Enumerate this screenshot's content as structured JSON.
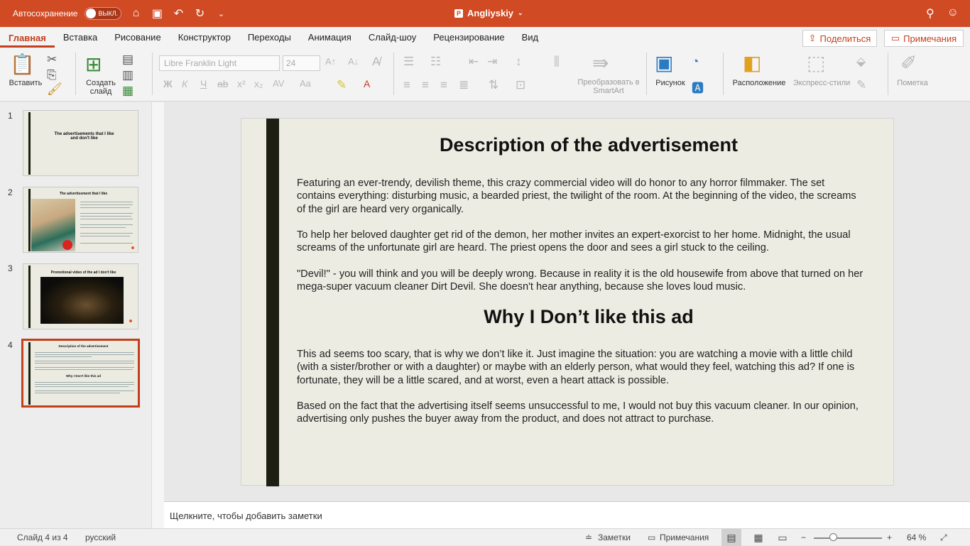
{
  "titlebar": {
    "autosave_label": "Автосохранение",
    "autosave_state": "ВЫКЛ.",
    "doc_title": "Angliyskiy"
  },
  "tabs": [
    "Главная",
    "Вставка",
    "Рисование",
    "Конструктор",
    "Переходы",
    "Анимация",
    "Слайд-шоу",
    "Рецензирование",
    "Вид"
  ],
  "share_label": "Поделиться",
  "comments_label": "Примечания",
  "ribbon": {
    "paste_label": "Вставить",
    "new_slide_label": "Создать слайд",
    "font_name": "Libre Franklin Light",
    "font_size": "24",
    "smartart_label": "Преобразовать в SmartArt",
    "picture_label": "Рисунок",
    "arrange_label": "Расположение",
    "quickstyles_label": "Экспресс-стили",
    "designer_label": "Пометка"
  },
  "thumbnails": [
    {
      "num": "1",
      "title": "The advertisements that I like and don't like"
    },
    {
      "num": "2",
      "title": "The advertisement that I like"
    },
    {
      "num": "3",
      "title": "Promotional video of the ad I don't like"
    },
    {
      "num": "4",
      "title": "Description of the advertisement",
      "subtitle": "Why I Don't like this ad"
    }
  ],
  "slide": {
    "heading1": "Description of the advertisement",
    "p1": "Featuring an ever-trendy, devilish theme, this crazy commercial video will do honor to any horror filmmaker. The set contains everything: disturbing music, a bearded priest, the twilight of the room. At the beginning of the video, the screams of the girl are heard very organically.",
    "p2": "To help her beloved daughter get rid of the demon, her mother invites an expert-exorcist to her home. Midnight, the usual screams of the unfortunate girl are heard. The priest opens the door and sees a girl stuck to the ceiling.",
    "p3": "\"Devil!\" - you will think and you will be deeply wrong. Because in reality it is the old housewife from above that turned on her mega-super vacuum cleaner Dirt Devil. She doesn't hear anything, because she loves loud music.",
    "heading2": "Why I Don’t like this ad",
    "p4": "This ad seems too scary, that is why we don’t like it. Just imagine the situation: you are watching a movie with a little child (with a sister/brother or with a daughter) or maybe with an elderly person, what would they feel, watching this ad? If one is fortunate, they will be a little scared, and at worst, even a heart attack is possible.",
    "p5": "Based on the fact that the advertising itself seems unsuccessful to me, I would not buy this vacuum cleaner. In our opinion, advertising only pushes the buyer away from the product, and does not attract to purchase."
  },
  "notes_placeholder": "Щелкните, чтобы добавить заметки",
  "status": {
    "slide_of": "Слайд 4 из 4",
    "language": "русский",
    "notes_label": "Заметки",
    "comments_label": "Примечания",
    "zoom": "64 %",
    "zoom_fraction": 0.28
  },
  "colors": {
    "accent": "#c43e1c",
    "titlebar": "#d04a24",
    "slide_bg": "#edece2",
    "slide_bar": "#1c1f12"
  }
}
